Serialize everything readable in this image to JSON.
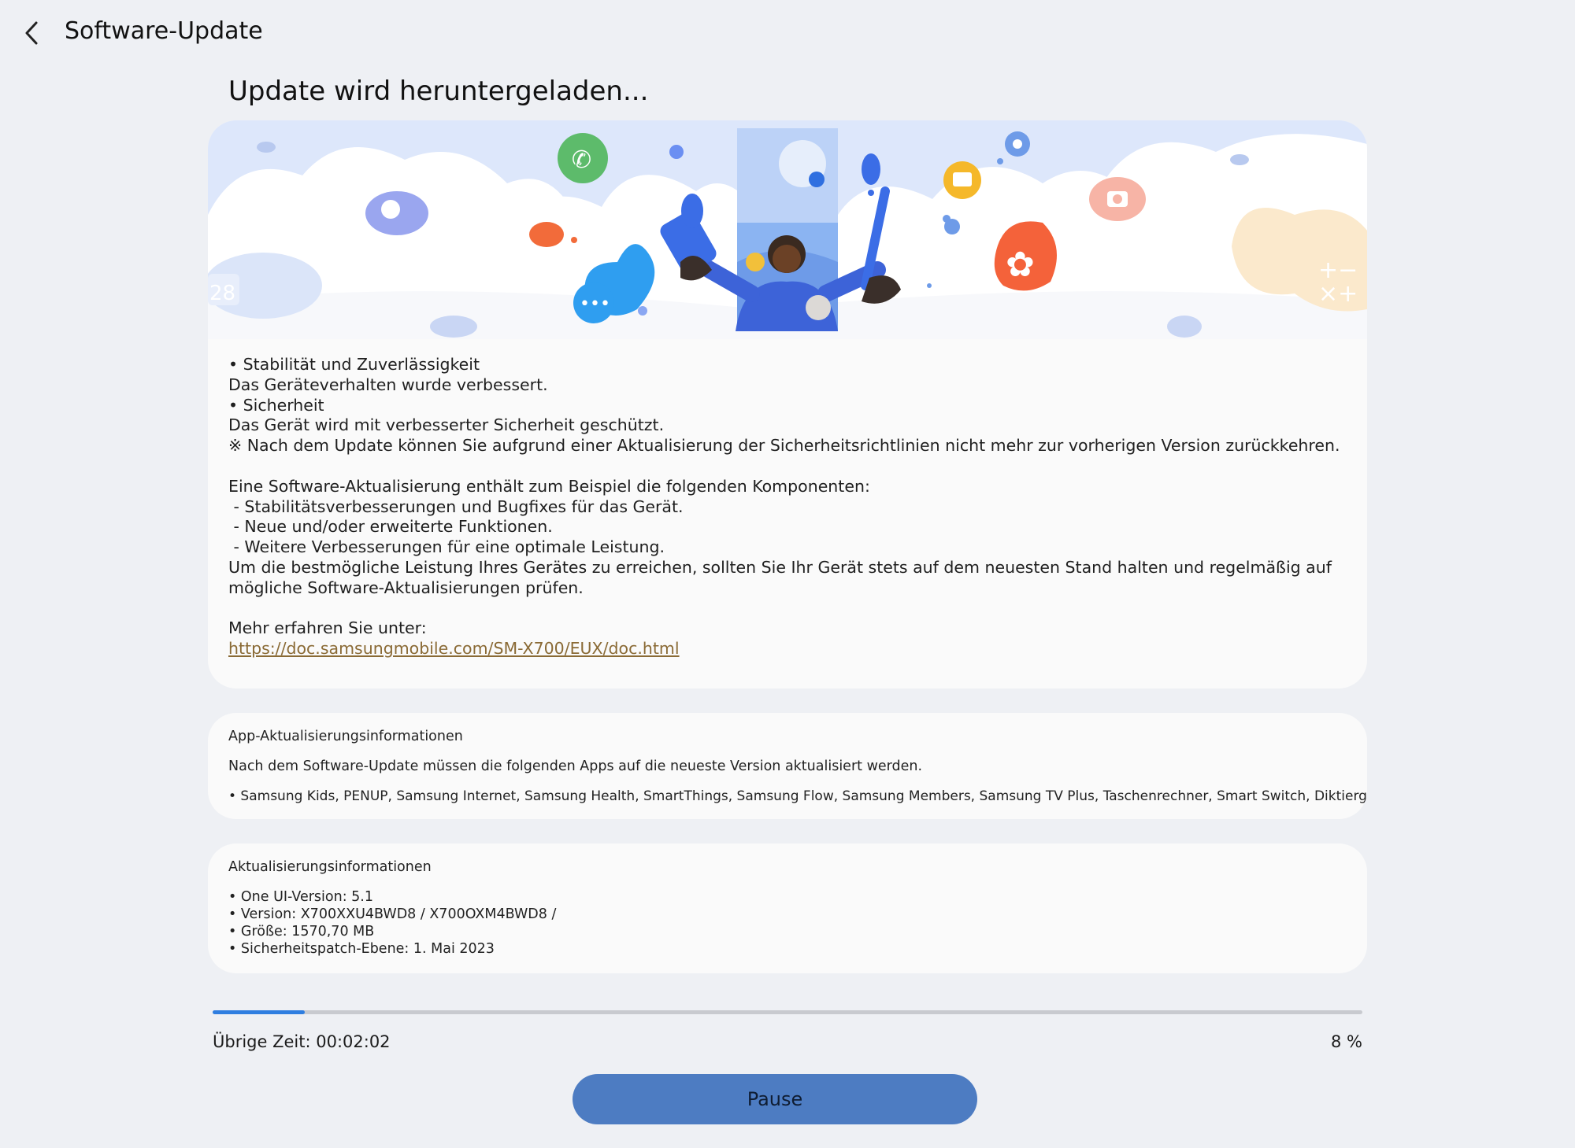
{
  "header": {
    "title": "Software-Update",
    "back_icon": "chevron-left-icon"
  },
  "main": {
    "heading": "Update wird heruntergeladen...",
    "illustration": "update-illustration",
    "notes": [
      "• Stabilität und Zuverlässigkeit",
      "Das Geräteverhalten wurde verbessert.",
      "• Sicherheit",
      "Das Gerät wird mit verbesserter Sicherheit geschützt.",
      "※ Nach dem Update können Sie aufgrund einer Aktualisierung der Sicherheitsrichtlinien nicht mehr zur vorherigen Version zurückkehren.",
      "",
      "Eine Software-Aktualisierung enthält zum Beispiel die folgenden Komponenten:",
      " - Stabilitätsverbesserungen und Bugfixes für das Gerät.",
      " - Neue und/oder erweiterte Funktionen.",
      " - Weitere Verbesserungen für eine optimale Leistung.",
      "Um die bestmögliche Leistung Ihres Gerätes zu erreichen, sollten Sie Ihr Gerät stets auf dem neuesten Stand halten und regelmäßig auf mögliche Software-Aktualisierungen prüfen.",
      "",
      "Mehr erfahren Sie unter:"
    ],
    "link": "https://doc.samsungmobile.com/SM-X700/EUX/doc.html"
  },
  "app_updates": {
    "title": "App-Aktualisierungsinformationen",
    "description": "Nach dem Software-Update müssen die folgenden Apps auf die neueste Version aktualisiert werden.",
    "apps": "• Samsung Kids, PENUP, Samsung Internet, Samsung Health, SmartThings, Samsung Flow, Samsung Members, Samsung TV Plus, Taschenrechner, Smart Switch, Diktiergerät"
  },
  "update_info": {
    "title": "Aktualisierungsinformationen",
    "items": [
      "• One UI-Version: 5.1",
      "• Version: X700XXU4BWD8 / X700OXM4BWD8 /",
      "• Größe: 1570,70 MB",
      "• Sicherheitspatch-Ebene: 1. Mai 2023"
    ]
  },
  "progress": {
    "value_percent": 8,
    "percent_label": "8 %",
    "time_left": "Übrige Zeit: 00:02:02",
    "fill_color": "#2f7ee0"
  },
  "pause_button": {
    "label": "Pause",
    "color": "#4d7cc2"
  }
}
